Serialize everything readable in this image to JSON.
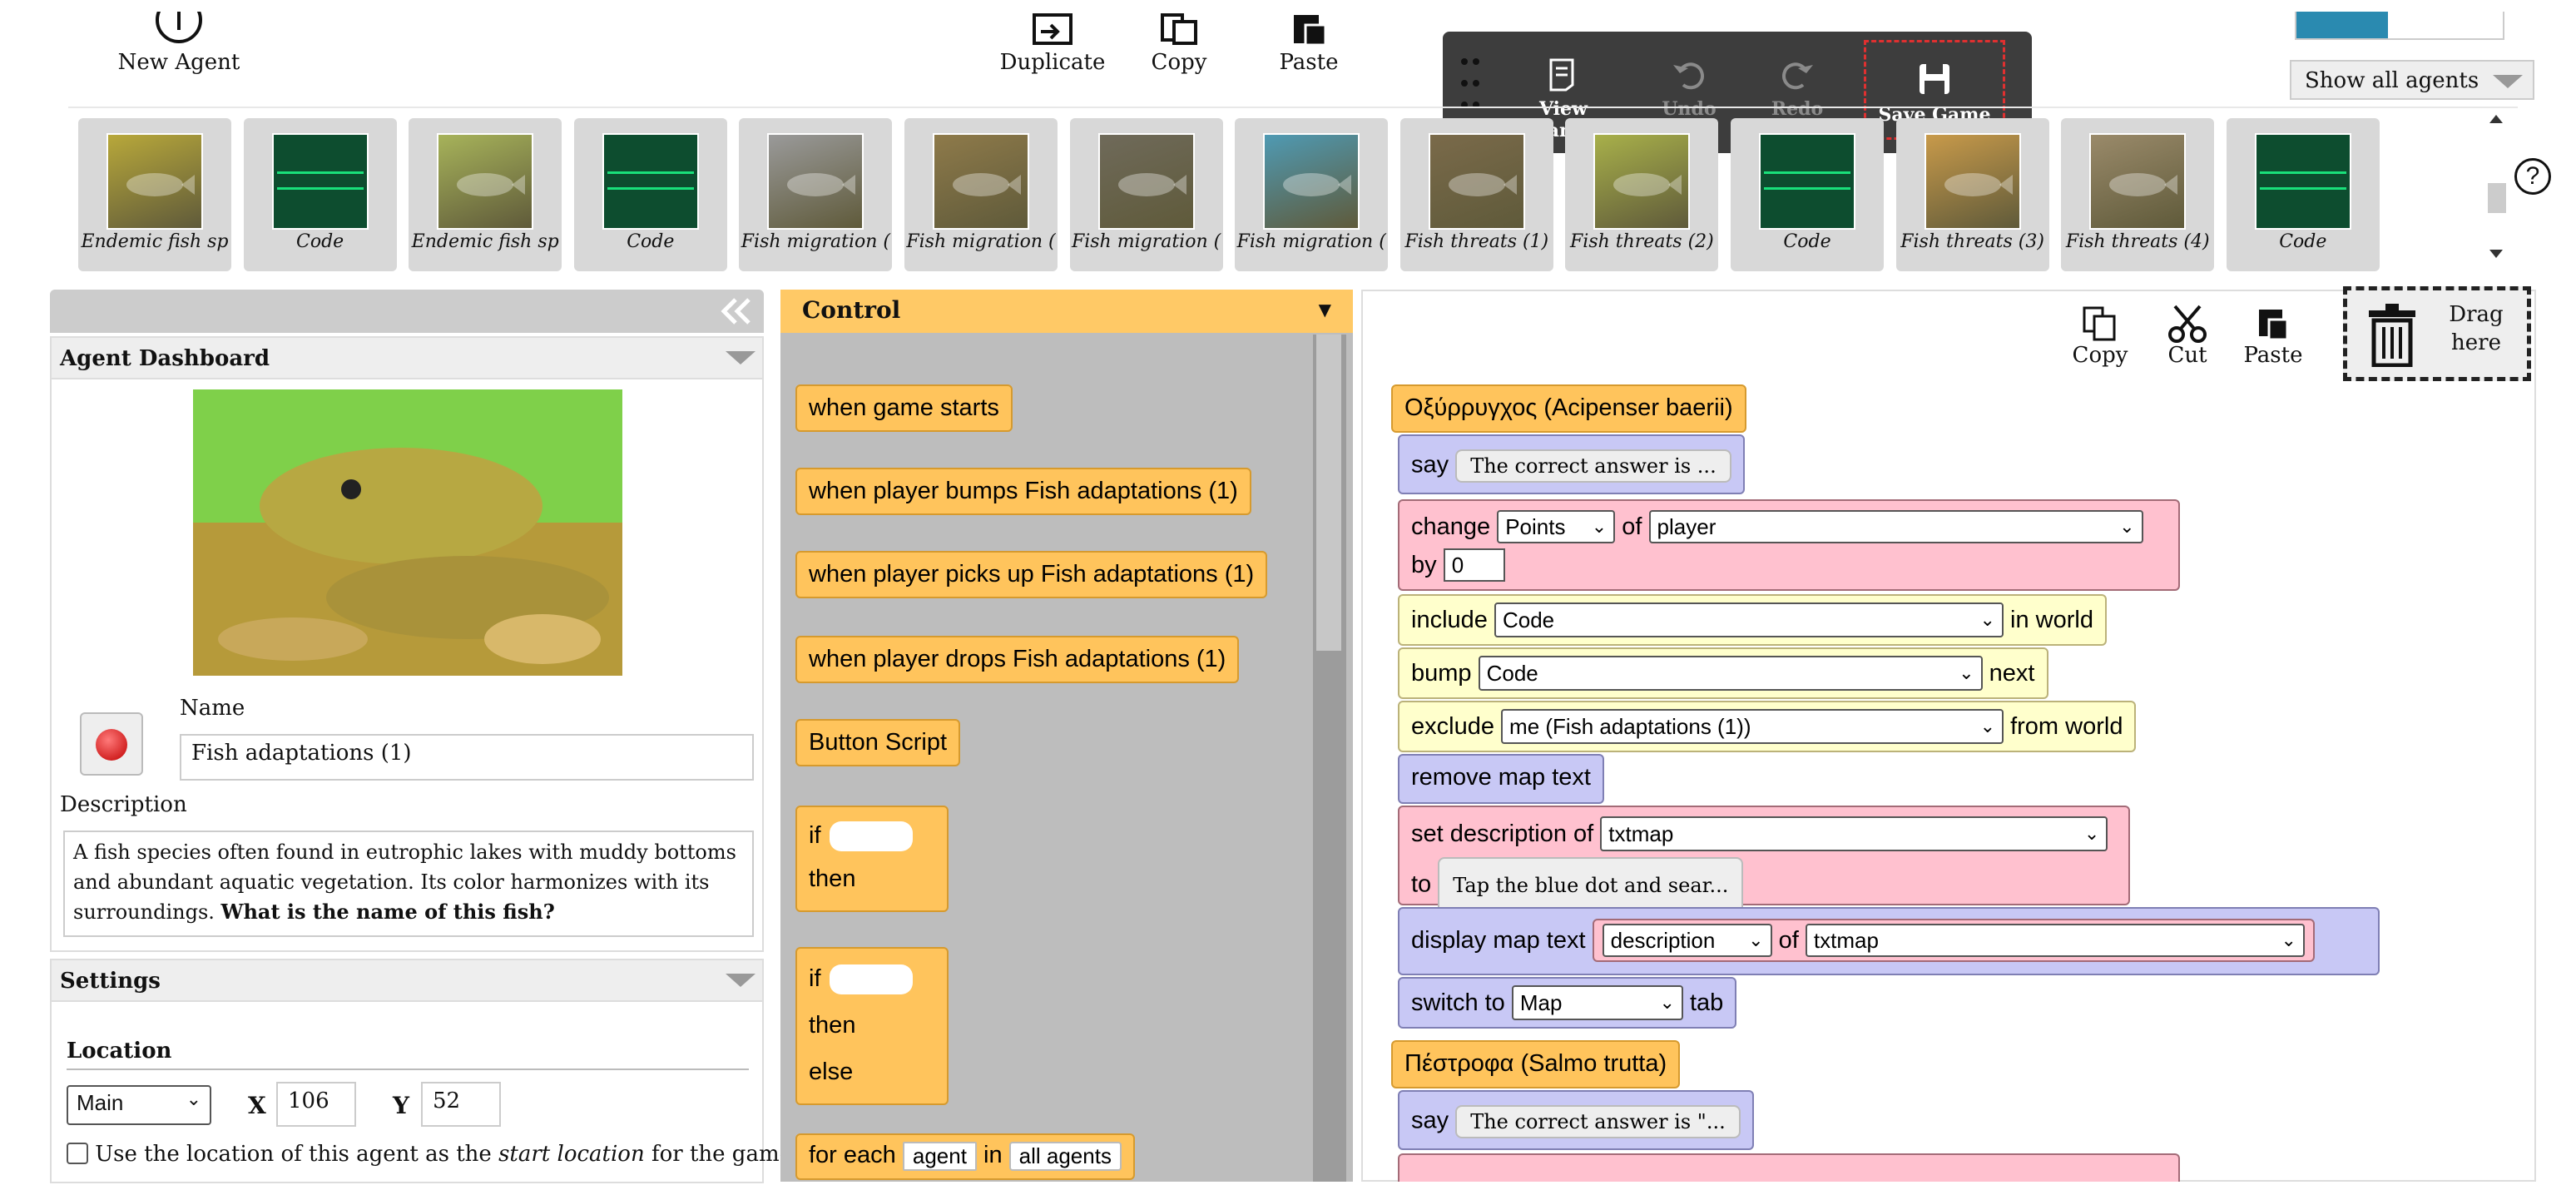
{
  "toolbar": {
    "new_agent": "New Agent",
    "duplicate": "Duplicate",
    "copy": "Copy",
    "paste": "Paste"
  },
  "overlay": {
    "view_changes": "View Changes",
    "undo": "Undo",
    "redo": "Redo",
    "save_game": "Save Game"
  },
  "show_all": "Show all agents",
  "help": "?",
  "agents": [
    {
      "label": "Endemic fish sp",
      "kind": "photo",
      "color": "#b8a83a"
    },
    {
      "label": "Code",
      "kind": "code"
    },
    {
      "label": "Endemic fish sp",
      "kind": "photo",
      "color": "#a7b35a"
    },
    {
      "label": "Code",
      "kind": "code"
    },
    {
      "label": "Fish migration (",
      "kind": "photo",
      "color": "#9a9a9a"
    },
    {
      "label": "Fish migration (",
      "kind": "photo",
      "color": "#8e7a4a"
    },
    {
      "label": "Fish migration (",
      "kind": "photo",
      "color": "#6f6a5a"
    },
    {
      "label": "Fish migration (",
      "kind": "photo",
      "color": "#4f9ab3"
    },
    {
      "label": "Fish threats (1)",
      "kind": "photo",
      "color": "#7a6a4a"
    },
    {
      "label": "Fish threats (2)",
      "kind": "photo",
      "color": "#a8b04a"
    },
    {
      "label": "Code",
      "kind": "code"
    },
    {
      "label": "Fish threats (3)",
      "kind": "photo",
      "color": "#c89a4a"
    },
    {
      "label": "Fish threats (4)",
      "kind": "photo",
      "color": "#9a8a6a"
    },
    {
      "label": "Code",
      "kind": "code"
    }
  ],
  "dashboard": {
    "title": "Agent Dashboard",
    "name_label": "Name",
    "name_value": "Fish adaptations (1)",
    "desc_label": "Description",
    "desc_text": "A fish species often found in eutrophic lakes with muddy bottoms and abundant aquatic vegetation. Its color harmonizes with its surroundings. ",
    "desc_bold": "What is the name of this fish?"
  },
  "settings": {
    "title": "Settings",
    "location_label": "Location",
    "world": "Main",
    "x_label": "X",
    "x_value": "106",
    "y_label": "Y",
    "y_value": "52",
    "start_pre": "Use the location of this agent as the ",
    "start_em": "start location",
    "start_post": " for the game."
  },
  "palette": {
    "title": "Control",
    "blocks": [
      "when game starts",
      "when player bumps Fish adaptations (1)",
      "when player picks up Fish adaptations (1)",
      "when player drops Fish adaptations (1)",
      "Button Script"
    ],
    "if": "if",
    "then": "then",
    "else": "else",
    "for_each": "for each",
    "agent": "agent",
    "in": "in",
    "all_agents": "all agents"
  },
  "workspace": {
    "copy": "Copy",
    "cut": "Cut",
    "paste": "Paste",
    "drag": "Drag\nhere",
    "b1": "Οξύρρυγχος (Acipenser baerii)",
    "say": "say",
    "say1": "The correct answer is  ...",
    "change": "change",
    "points": "Points",
    "of": "of",
    "player": "player",
    "by": "by",
    "by_val": "0",
    "include": "include",
    "code": "Code",
    "in_world": "in world",
    "bump": "bump",
    "next": "next",
    "exclude": "exclude",
    "me": "me (Fish adaptations (1))",
    "from_world": "from world",
    "remove_map": "remove map text",
    "set_desc": "set description of",
    "txtmap": "txtmap",
    "to": "to",
    "tap": "Tap the blue dot and sear...",
    "display_map": "display map text",
    "description": "description",
    "switch": "switch to",
    "map": "Map",
    "tab": "tab",
    "b2": "Πέστροφα (Salmo trutta)",
    "say2": "The correct answer is \"..."
  }
}
